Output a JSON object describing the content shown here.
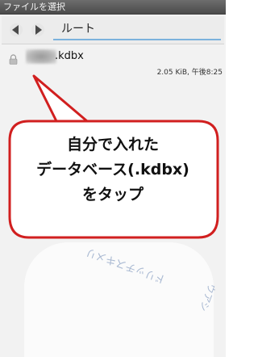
{
  "window": {
    "title": "ファイルを選択"
  },
  "toolbar": {
    "back_icon": "back-arrow-icon",
    "forward_icon": "forward-arrow-icon",
    "path": "ルート"
  },
  "file": {
    "name": ".kdbx",
    "meta": "2.05 KiB, 午後8:25",
    "icon": "lock-icon"
  },
  "watermark": {
    "line1": "ドリッチスキメリ",
    "line2": "ウアシ"
  },
  "callout": {
    "line1": "自分で入れた",
    "line2": "データベース(.kdbx)",
    "line3": "をタップ",
    "border_color": "#d11f1f",
    "fill_color": "#ffffff"
  }
}
